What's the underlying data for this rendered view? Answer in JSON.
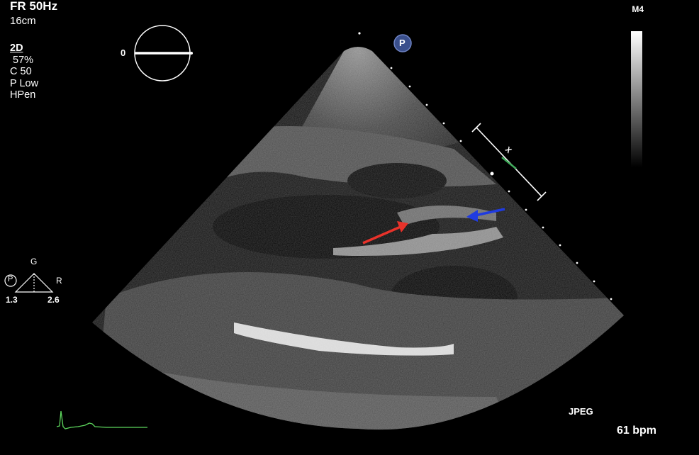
{
  "header": {
    "frame_rate": "FR 50Hz",
    "depth": "16cm"
  },
  "params": {
    "mode": "2D",
    "gain": " 57%",
    "compress": "C 50",
    "power": "P Low",
    "harmonics": "HPen"
  },
  "probe": {
    "label": "M4",
    "marker": "P"
  },
  "angle": {
    "value": "0"
  },
  "triangle": {
    "g": "G",
    "r": "R",
    "marker": "P",
    "left_val": "1.3",
    "right_val": "2.6"
  },
  "caliper": {
    "marker": "X"
  },
  "footer": {
    "format": "JPEG",
    "heart_rate": "61 bpm"
  },
  "annotations": {
    "red_arrow_color": "#e8322a",
    "blue_arrow_color": "#1f3be0"
  },
  "colors": {
    "ecg_trace": "#5dd65d",
    "probe_badge": "#3a4f8c"
  }
}
